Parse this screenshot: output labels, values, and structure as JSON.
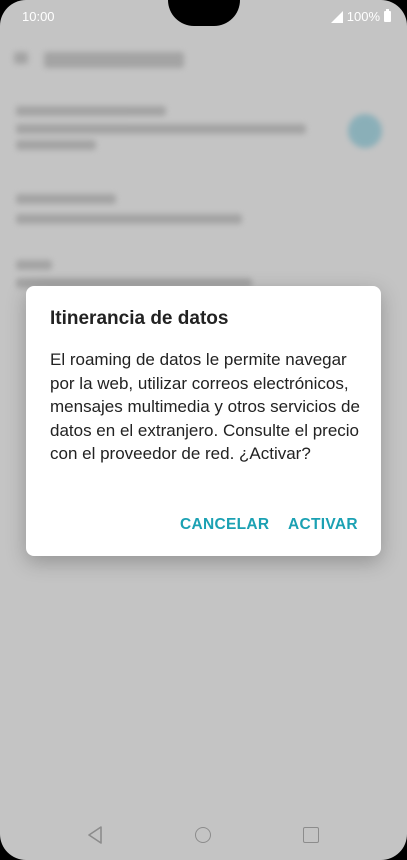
{
  "status_bar": {
    "time": "10:00",
    "battery": "100%"
  },
  "dialog": {
    "title": "Itinerancia de datos",
    "message": "El roaming de datos le permite navegar por la web, utilizar correos electrónicos, mensajes multimedia y otros servicios de datos en el extranjero. Consulte el precio con el proveedor de red. ¿Activar?",
    "cancel_label": "CANCELAR",
    "confirm_label": "ACTIVAR"
  },
  "colors": {
    "accent": "#1ba1b3",
    "scrim": "#c4c4c4"
  },
  "icons": {
    "signal": "signal-icon",
    "battery": "battery-icon",
    "back": "back-icon",
    "home": "home-icon",
    "recents": "recents-icon"
  }
}
